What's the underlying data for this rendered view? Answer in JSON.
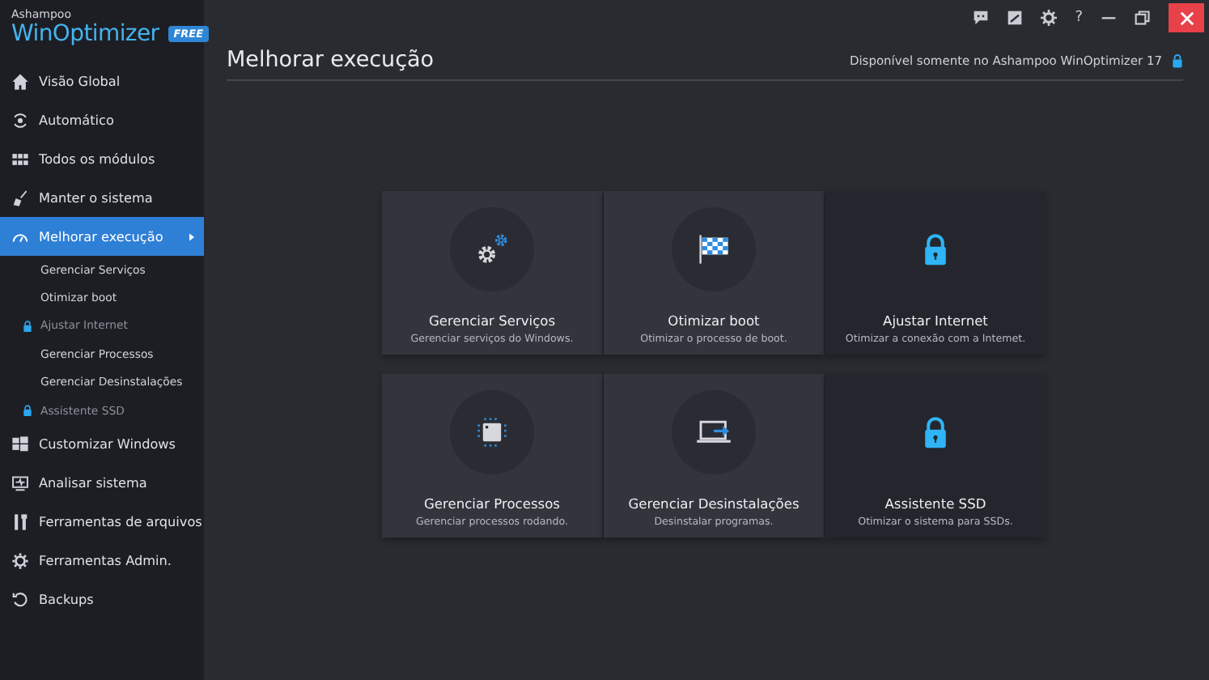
{
  "brand": {
    "company": "Ashampoo",
    "product": "WinOptimizer",
    "badge": "FREE"
  },
  "titlebar": {
    "help": "?"
  },
  "sidebar": {
    "items": [
      {
        "kind": "main",
        "label": "Visão Global",
        "selected": false
      },
      {
        "kind": "main",
        "label": "Automático",
        "selected": false
      },
      {
        "kind": "main",
        "label": "Todos os módulos",
        "selected": false
      },
      {
        "kind": "main",
        "label": "Manter o sistema",
        "selected": false
      },
      {
        "kind": "main",
        "label": "Melhorar execução",
        "selected": true
      },
      {
        "kind": "sub",
        "label": "Gerenciar Serviços",
        "locked": false,
        "selected": false
      },
      {
        "kind": "sub",
        "label": "Otimizar boot",
        "locked": false,
        "selected": false
      },
      {
        "kind": "sub",
        "label": "Ajustar Internet",
        "locked": true,
        "selected": false
      },
      {
        "kind": "sub",
        "label": "Gerenciar Processos",
        "locked": false,
        "selected": false
      },
      {
        "kind": "sub",
        "label": "Gerenciar Desinstalações",
        "locked": false,
        "selected": false
      },
      {
        "kind": "sub",
        "label": "Assistente SSD",
        "locked": true,
        "selected": false
      },
      {
        "kind": "main",
        "label": "Customizar Windows",
        "selected": false
      },
      {
        "kind": "main",
        "label": "Analisar sistema",
        "selected": false
      },
      {
        "kind": "main",
        "label": "Ferramentas de arquivos",
        "selected": false
      },
      {
        "kind": "main",
        "label": "Ferramentas Admin.",
        "selected": false
      },
      {
        "kind": "main",
        "label": "Backups",
        "selected": false
      }
    ]
  },
  "header": {
    "title": "Melhorar execução",
    "notice": "Disponível somente no Ashampoo WinOptimizer 17"
  },
  "tiles": [
    {
      "title": "Gerenciar Serviços",
      "description": "Gerenciar serviços do Windows.",
      "locked": false
    },
    {
      "title": "Otimizar boot",
      "description": "Otimizar o processo de boot.",
      "locked": false
    },
    {
      "title": "Ajustar Internet",
      "description": "Otimizar a conexão com a Intemet.",
      "locked": true
    },
    {
      "title": "Gerenciar Processos",
      "description": "Gerenciar processos rodando.",
      "locked": false
    },
    {
      "title": "Gerenciar Desinstalações",
      "description": "Desinstalar programas.",
      "locked": false
    },
    {
      "title": "Assistente SSD",
      "description": "Otimizar o sistema para SSDs.",
      "locked": true
    }
  ]
}
